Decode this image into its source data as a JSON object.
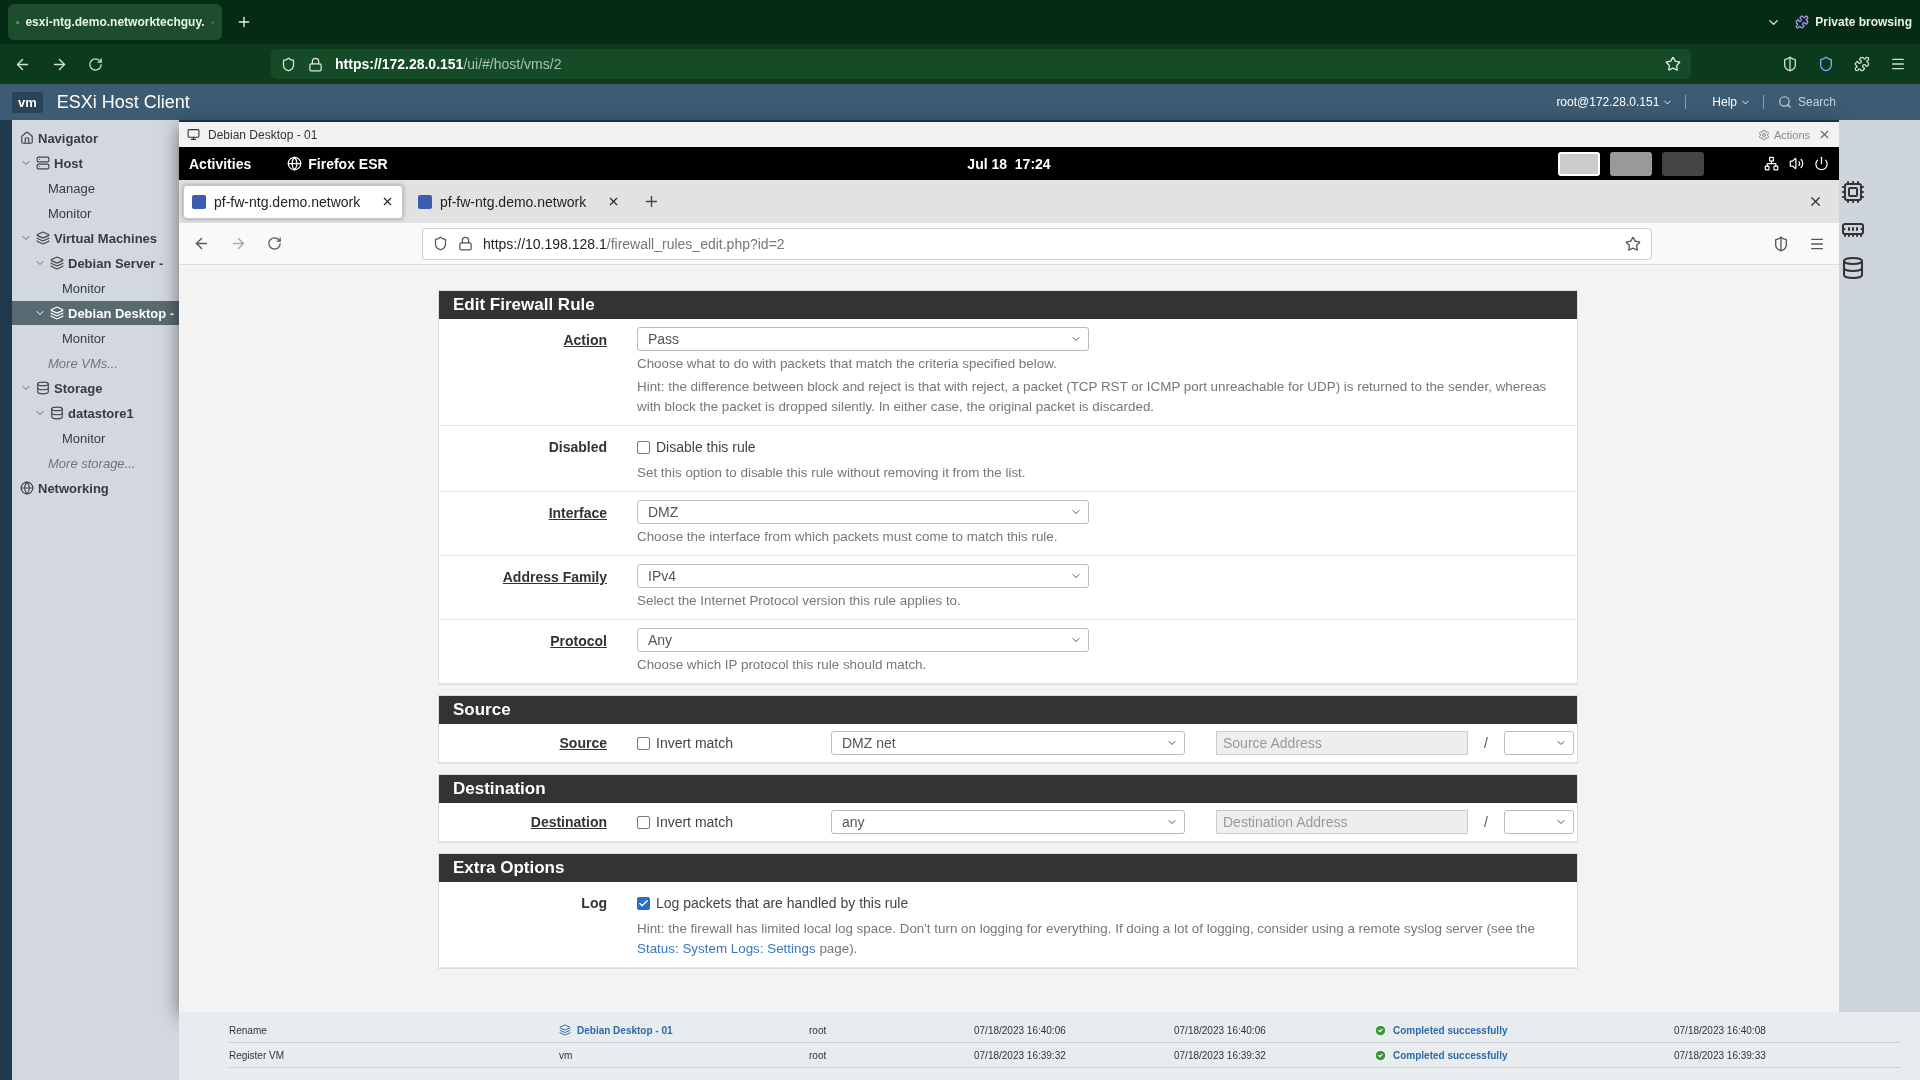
{
  "browser": {
    "tabs": [
      {
        "label": "esxi-ntg.demo.networktechguy.",
        "selected": true
      }
    ],
    "private_label": "Private browsing",
    "url_host": "https://172.28.0.151",
    "url_path": "/ui/#/host/vms/2"
  },
  "esxi": {
    "title": "ESXi Host Client",
    "logo": "vm",
    "user": "root@172.28.0.151",
    "help": "Help",
    "search_placeholder": "Search"
  },
  "navigator": {
    "items": [
      {
        "label": "Navigator",
        "kind": "heading",
        "selected": false
      },
      {
        "label": "Host",
        "kind": "host",
        "selected": false,
        "expanded": true,
        "children": [
          {
            "label": "Manage",
            "kind": "page",
            "selected": false
          },
          {
            "label": "Monitor",
            "kind": "page",
            "selected": false
          }
        ]
      },
      {
        "label": "Virtual Machines",
        "kind": "vms",
        "selected": false,
        "expanded": true,
        "children": [
          {
            "label": "Debian Server -",
            "kind": "vm",
            "selected": false,
            "expanded": true,
            "children": [
              {
                "label": "Monitor",
                "kind": "page",
                "selected": false
              }
            ]
          },
          {
            "label": "Debian Desktop -",
            "kind": "vm",
            "selected": true,
            "expanded": true,
            "children": [
              {
                "label": "Monitor",
                "kind": "page",
                "selected": false
              }
            ]
          },
          {
            "label": "More VMs...",
            "kind": "more",
            "selected": false
          }
        ]
      },
      {
        "label": "Storage",
        "kind": "storage",
        "selected": false,
        "expanded": true,
        "children": [
          {
            "label": "datastore1",
            "kind": "datastore",
            "selected": false,
            "expanded": true,
            "children": [
              {
                "label": "Monitor",
                "kind": "page",
                "selected": false
              }
            ]
          },
          {
            "label": "More storage...",
            "kind": "more",
            "selected": false
          }
        ]
      },
      {
        "label": "Networking",
        "kind": "network",
        "selected": false
      }
    ]
  },
  "console": {
    "title": "Debian Desktop - 01",
    "actions": "Actions",
    "gnome": {
      "activities": "Activities",
      "app": "Firefox ESR",
      "clock": "Jul 18  17:24",
      "workspaces": [
        {
          "selected": true
        },
        {
          "selected": false
        },
        {
          "selected": false
        }
      ]
    },
    "firefox": {
      "tabs": [
        {
          "label": "pf-fw-ntg.demo.network",
          "selected": true
        },
        {
          "label": "pf-fw-ntg.demo.network",
          "selected": false
        }
      ],
      "url_host": "https://10.198.128.1",
      "url_path": "/firewall_rules_edit.php?id=2"
    },
    "sections": [
      {
        "title": "Edit Firewall Rule",
        "rows": [
          {
            "kind": "select",
            "label": "Action",
            "linked": true,
            "value": "Pass",
            "help": [
              "Choose what to do with packets that match the criteria specified below.",
              "Hint: the difference between block and reject is that with reject, a packet (TCP RST or ICMP port unreachable for UDP) is returned to the sender, whereas with block the packet is dropped silently. In either case, the original packet is discarded."
            ]
          },
          {
            "kind": "checkbox",
            "label": "Disabled",
            "linked": false,
            "checked": false,
            "check_label": "Disable this rule",
            "help": [
              "Set this option to disable this rule without removing it from the list."
            ]
          },
          {
            "kind": "select",
            "label": "Interface",
            "linked": true,
            "value": "DMZ",
            "help": [
              "Choose the interface from which packets must come to match this rule."
            ]
          },
          {
            "kind": "select",
            "label": "Address Family",
            "linked": true,
            "value": "IPv4",
            "help": [
              "Select the Internet Protocol version this rule applies to."
            ]
          },
          {
            "kind": "select",
            "label": "Protocol",
            "linked": true,
            "value": "Any",
            "help": [
              "Choose which IP protocol this rule should match."
            ]
          }
        ]
      },
      {
        "title": "Source",
        "rows": [
          {
            "kind": "address",
            "label": "Source",
            "linked": true,
            "checked": false,
            "check_label": "Invert match",
            "value": "DMZ net",
            "placeholder": "Source Address",
            "slash": "/"
          }
        ]
      },
      {
        "title": "Destination",
        "rows": [
          {
            "kind": "address",
            "label": "Destination",
            "linked": true,
            "checked": false,
            "check_label": "Invert match",
            "value": "any",
            "placeholder": "Destination Address",
            "slash": "/"
          }
        ]
      },
      {
        "title": "Extra Options",
        "rows": [
          {
            "kind": "checkbox",
            "label": "Log",
            "linked": false,
            "checked": true,
            "check_label": "Log packets that are handled by this rule",
            "help": [
              "Hint: the firewall has limited local log space. Don't turn on logging for everything. If doing a lot of logging, consider using a remote syslog server (see the"
            ],
            "link": "Status: System Logs: Settings",
            "help_after": "page)."
          }
        ]
      }
    ]
  },
  "tasks": [
    {
      "task": "Rename",
      "target": "Debian Desktop - 01",
      "target_link": true,
      "initiator": "root",
      "queued": "07/18/2023 16:40:06",
      "started": "07/18/2023 16:40:06",
      "result": "Completed successfully",
      "completed": "07/18/2023 16:40:08"
    },
    {
      "task": "Register VM",
      "target": "vm",
      "target_link": false,
      "initiator": "root",
      "queued": "07/18/2023 16:39:32",
      "started": "07/18/2023 16:39:32",
      "result": "Completed successfully",
      "completed": "07/18/2023 16:39:33"
    }
  ]
}
